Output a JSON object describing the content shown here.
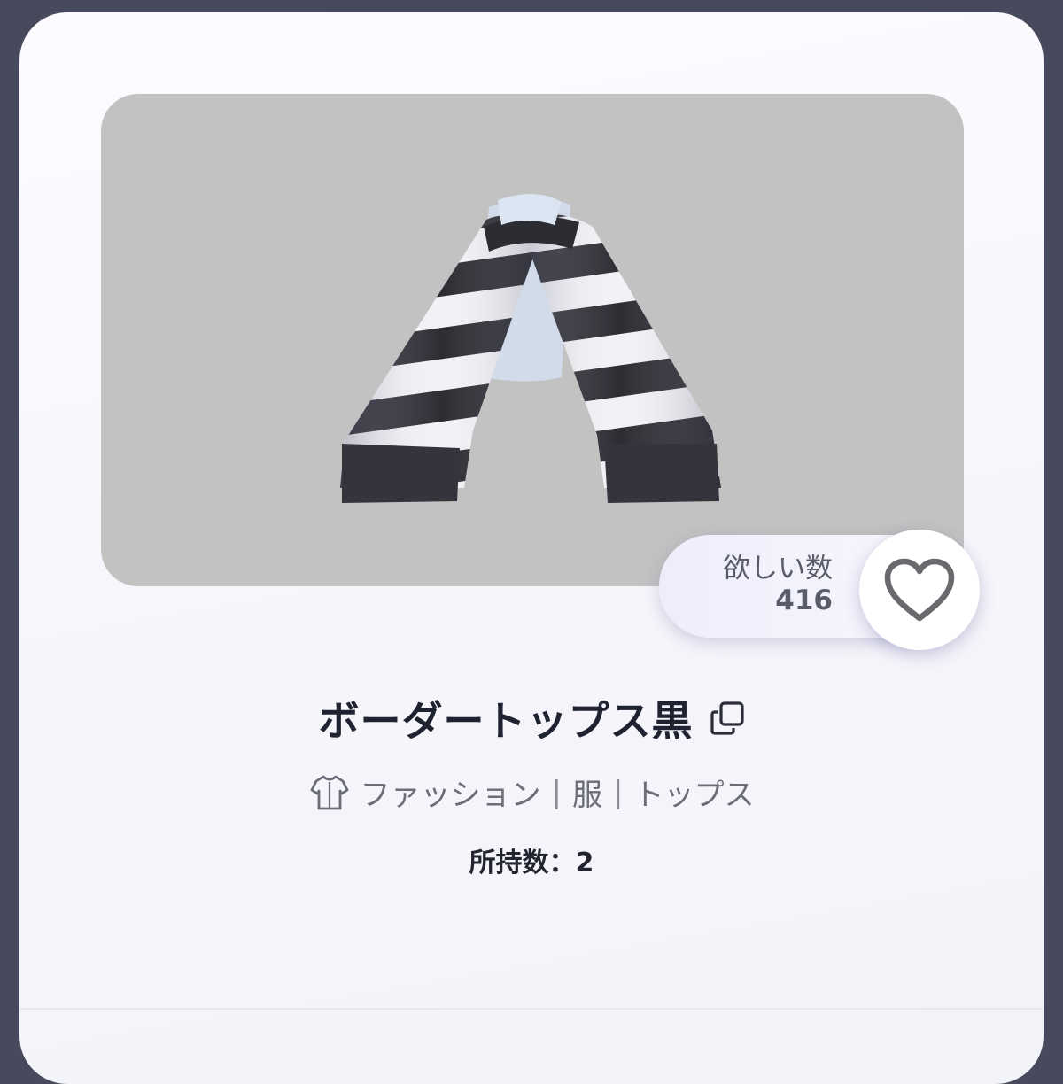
{
  "item": {
    "name": "ボーダートップス黒",
    "categories": [
      "ファッション",
      "服",
      "トップス"
    ],
    "separator": "|",
    "owned_label": "所持数：2"
  },
  "wishlist": {
    "label": "欲しい数",
    "count": "416"
  },
  "icons": {
    "wish": "heart-icon",
    "copy": "copy-icon",
    "category": "shirt-icon"
  },
  "colors": {
    "preview_bg": "#c2c2c2",
    "stripe_dark": "#2a2a30",
    "stripe_light": "#f4f4f8"
  }
}
